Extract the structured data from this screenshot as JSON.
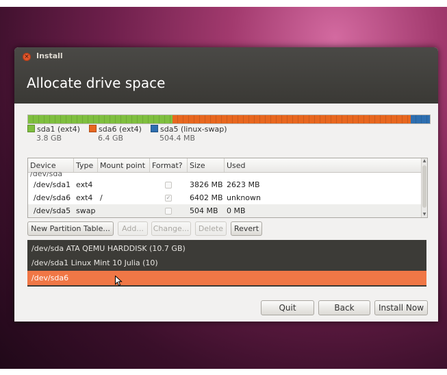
{
  "window": {
    "title": "Install",
    "page_title": "Allocate drive space"
  },
  "diskbar": {
    "segments": [
      {
        "name": "sda1",
        "fraction": 0.359,
        "color": "#7fbf3f"
      },
      {
        "name": "sda6",
        "fraction": 0.594,
        "color": "#e8671f"
      },
      {
        "name": "sda5",
        "fraction": 0.047,
        "color": "#2e6fb0"
      }
    ]
  },
  "legend": [
    {
      "label": "sda1 (ext4)",
      "size": "3.8 GB",
      "color": "#7fbf3f"
    },
    {
      "label": "sda6 (ext4)",
      "size": "6.4 GB",
      "color": "#e8671f"
    },
    {
      "label": "sda5 (linux-swap)",
      "size": "504.4 MB",
      "color": "#2e6fb0"
    }
  ],
  "table": {
    "headers": [
      "Device",
      "Type",
      "Mount point",
      "Format?",
      "Size",
      "Used"
    ],
    "group_row": "/dev/sda",
    "rows": [
      {
        "device": "/dev/sda1",
        "type": "ext4",
        "mount": "",
        "format": false,
        "size": "3826 MB",
        "used": "2623 MB"
      },
      {
        "device": "/dev/sda6",
        "type": "ext4",
        "mount": "/",
        "format": true,
        "size": "6402 MB",
        "used": "unknown"
      },
      {
        "device": "/dev/sda5",
        "type": "swap",
        "mount": "",
        "format": false,
        "size": "504 MB",
        "used": "0 MB"
      }
    ]
  },
  "buttons": {
    "new_partition_table": "New Partition Table...",
    "add": "Add...",
    "change": "Change...",
    "delete": "Delete",
    "revert": "Revert",
    "quit": "Quit",
    "back": "Back",
    "install_now": "Install Now"
  },
  "boot_devices": [
    "/dev/sda ATA QEMU HARDDISK (10.7 GB)",
    "/dev/sda1 Linux Mint 10 Julia (10)",
    "/dev/sda6"
  ],
  "icons": {
    "close": "close-icon",
    "cursor": "mouse-pointer-icon",
    "checkbox": "checkbox-icon"
  }
}
